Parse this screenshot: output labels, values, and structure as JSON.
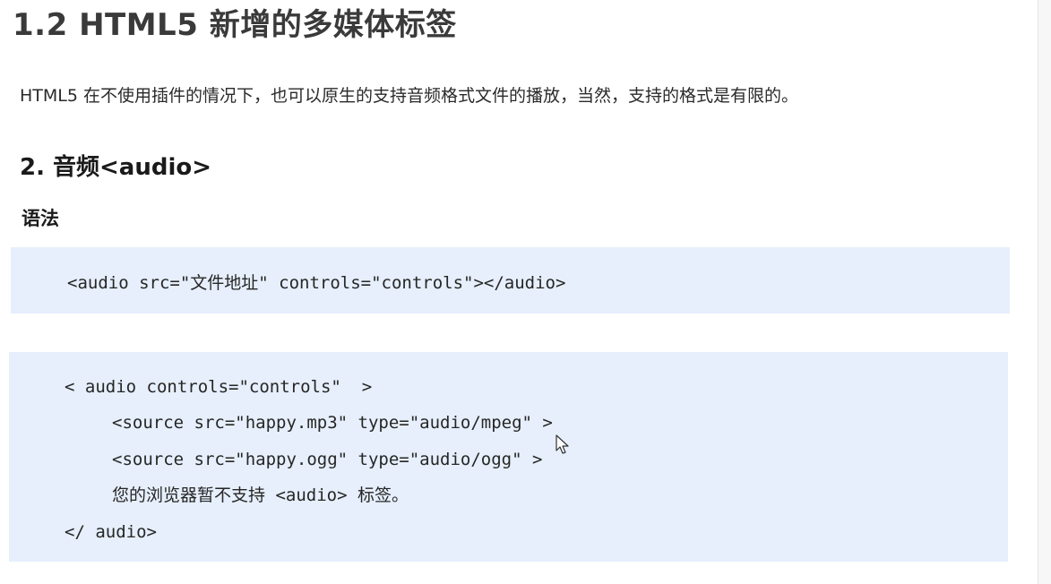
{
  "page": {
    "title": "1.2 HTML5 新增的多媒体标签",
    "intro": "HTML5 在不使用插件的情况下，也可以原生的支持音频格式文件的播放，当然，支持的格式是有限的。",
    "section_heading": "2. 音频<audio>",
    "syntax_label": "语法"
  },
  "code_block_1": {
    "line_1": "<audio src=\"文件地址\" controls=\"controls\"></audio>"
  },
  "code_block_2": {
    "lines": [
      "< audio controls=\"controls\"  >",
      "<source src=\"happy.mp3\" type=\"audio/mpeg\" >",
      "<source src=\"happy.ogg\" type=\"audio/ogg\" >",
      "您的浏览器暂不支持 <audio> 标签。",
      "</ audio>"
    ]
  },
  "icons": {
    "cursor": "mouse-pointer-icon"
  }
}
